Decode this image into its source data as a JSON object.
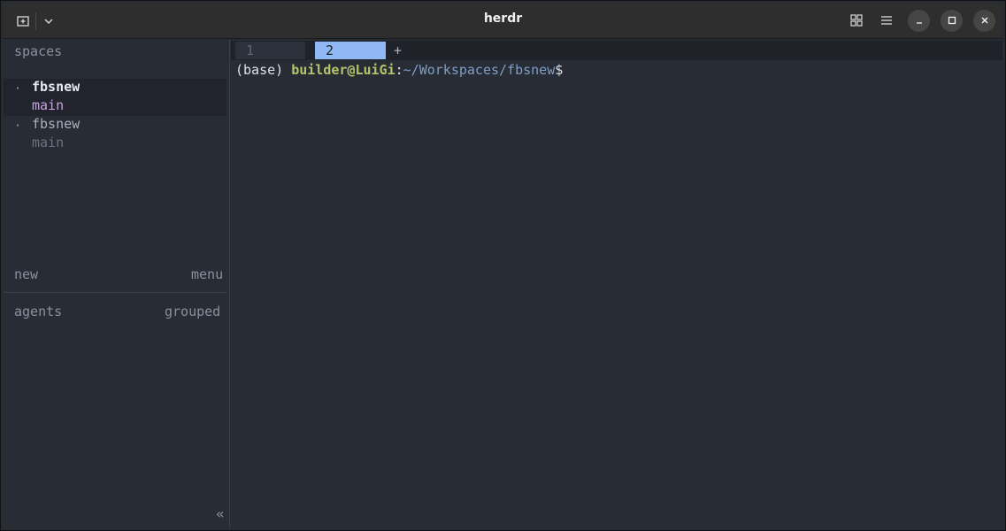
{
  "window": {
    "title": "herdr"
  },
  "icons": {
    "new_tab": "new-tab-icon",
    "dropdown": "chevron-down-icon",
    "grid": "grid-icon",
    "hamburger": "hamburger-menu-icon",
    "minimize": "minimize-icon",
    "maximize": "maximize-icon",
    "close": "close-icon"
  },
  "sidebar": {
    "spaces_title": "spaces",
    "spaces": [
      {
        "dot": "·",
        "name": "fbsnew",
        "branch": "main",
        "active": true
      },
      {
        "dot": "·",
        "name": "fbsnew",
        "branch": "main",
        "active": false
      }
    ],
    "new_label": "new",
    "menu_label": "menu",
    "agents_title": "agents",
    "grouped_label": "grouped",
    "collapse_glyph": "«"
  },
  "tabs": [
    {
      "label": "1",
      "active": false
    },
    {
      "label": "2",
      "active": true
    }
  ],
  "add_tab": "+",
  "terminal": {
    "env": "(base) ",
    "user_host": "builder@LuiGi",
    "colon": ":",
    "path": "~/Workspaces/fbsnew",
    "dollar": "$"
  },
  "colors": {
    "active_tab": "#8fb8f5",
    "user_host": "#b6c36b",
    "path": "#7f9ec6",
    "active_space_name": "#e6e9ef",
    "active_space_branch": "#c8a2e0"
  }
}
